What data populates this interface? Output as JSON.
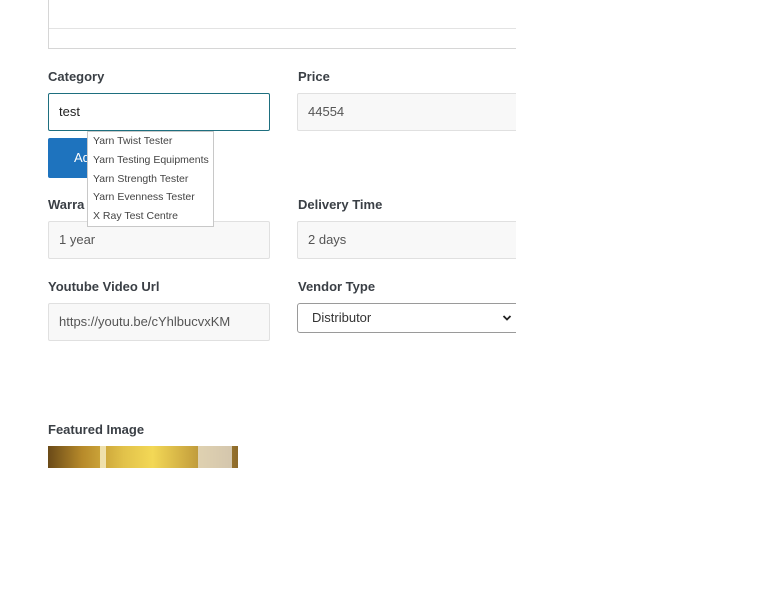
{
  "form": {
    "category": {
      "label": "Category",
      "value": "test"
    },
    "price": {
      "label": "Price",
      "value": "44554"
    },
    "add_button": {
      "label": "Ad"
    },
    "warranty": {
      "label": "Warra",
      "value": "1 year"
    },
    "delivery_time": {
      "label": "Delivery Time",
      "value": "2 days"
    },
    "youtube_url": {
      "label": "Youtube Video Url",
      "value": "https://youtu.be/cYhlbucvxKM"
    },
    "vendor_type": {
      "label": "Vendor Type",
      "selected": "Distributor"
    },
    "featured_image": {
      "label": "Featured Image"
    }
  },
  "autocomplete": {
    "items": [
      "Yarn Twist Tester",
      "Yarn Testing Equipments",
      "Yarn Strength Tester",
      "Yarn Evenness Tester",
      "X Ray Test Centre"
    ]
  },
  "icons": {
    "select_chevron": "chevron-down-icon"
  },
  "colors": {
    "primary_button": "#1e73be",
    "focus_border": "#1e6f7f"
  }
}
